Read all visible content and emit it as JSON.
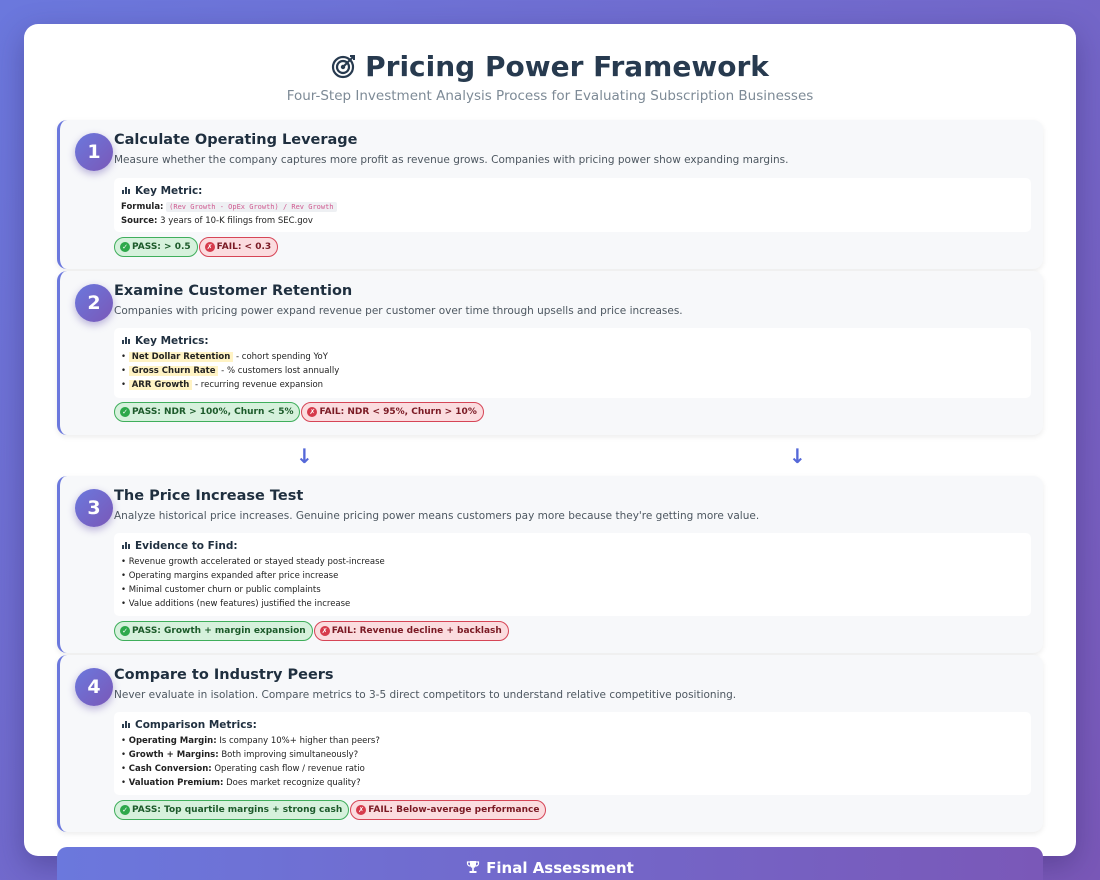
{
  "header": {
    "icon": "target-icon",
    "title": "Pricing Power Framework",
    "subtitle": "Four-Step Investment Analysis Process for Evaluating Subscription Businesses"
  },
  "colors": {
    "accent_start": "#6b78dd",
    "accent_end": "#7a58b8",
    "pass": "#2da84a",
    "fail": "#d63a4b"
  },
  "steps": [
    {
      "number": "1",
      "title": "Calculate Operating Leverage",
      "description": "Measure whether the company captures more profit as revenue grows. Companies with pricing power show expanding margins.",
      "box_title": "Key Metric:",
      "formula_label": "Formula:",
      "formula": "(Rev Growth - OpEx Growth) / Rev Growth",
      "source_label": "Source:",
      "source": "3 years of 10-K filings from SEC.gov",
      "pass": "PASS: > 0.5",
      "fail": "FAIL: < 0.3"
    },
    {
      "number": "2",
      "title": "Examine Customer Retention",
      "description": "Companies with pricing power expand revenue per customer over time through upsells and price increases.",
      "box_title": "Key Metrics:",
      "metrics": [
        {
          "name": "Net Dollar Retention",
          "text": "- cohort spending YoY"
        },
        {
          "name": "Gross Churn Rate",
          "text": "- % customers lost annually"
        },
        {
          "name": "ARR Growth",
          "text": "- recurring revenue expansion"
        }
      ],
      "pass": "PASS: NDR > 100%, Churn < 5%",
      "fail": "FAIL: NDR < 95%, Churn > 10%"
    },
    {
      "number": "3",
      "title": "The Price Increase Test",
      "description": "Analyze historical price increases. Genuine pricing power means customers pay more because they're getting more value.",
      "box_title": "Evidence to Find:",
      "items": [
        "Revenue growth accelerated or stayed steady post-increase",
        "Operating margins expanded after price increase",
        "Minimal customer churn or public complaints",
        "Value additions (new features) justified the increase"
      ],
      "pass": "PASS: Growth + margin expansion",
      "fail": "FAIL: Revenue decline + backlash"
    },
    {
      "number": "4",
      "title": "Compare to Industry Peers",
      "description": "Never evaluate in isolation. Compare metrics to 3-5 direct competitors to understand relative competitive positioning.",
      "box_title": "Comparison Metrics:",
      "metrics": [
        {
          "name": "Operating Margin:",
          "text": "Is company 10%+ higher than peers?"
        },
        {
          "name": "Growth + Margins:",
          "text": "Both improving simultaneously?"
        },
        {
          "name": "Cash Conversion:",
          "text": "Operating cash flow / revenue ratio"
        },
        {
          "name": "Valuation Premium:",
          "text": "Does market recognize quality?"
        }
      ],
      "pass": "PASS: Top quartile margins + strong cash",
      "fail": "FAIL: Below-average performance"
    }
  ],
  "glyphs": {
    "check": "✓",
    "cross": "✗",
    "bullet": "•",
    "arrow": "↓"
  },
  "final": {
    "icon": "trophy-icon",
    "title": "Final Assessment"
  }
}
